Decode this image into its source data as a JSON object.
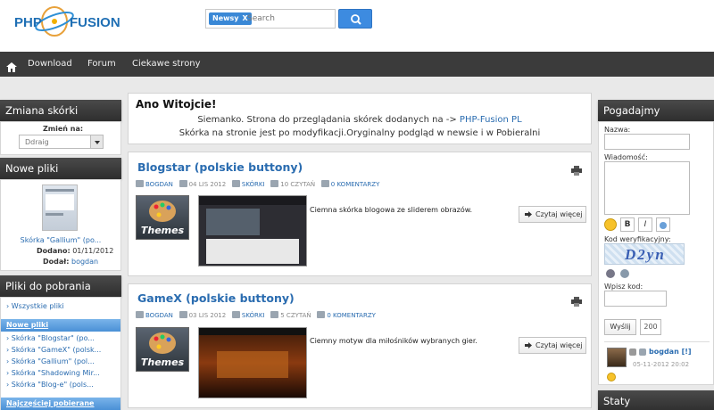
{
  "header": {
    "logo_text": "PHP-FUSION",
    "search": {
      "tag": "Newsy",
      "tag_close": "X",
      "placeholder": "Search",
      "value": ""
    }
  },
  "nav": {
    "items": [
      {
        "label": "Download"
      },
      {
        "label": "Forum"
      },
      {
        "label": "Ciekawe strony"
      }
    ]
  },
  "left": {
    "skin": {
      "title": "Zmiana skórki",
      "label": "Zmień na:",
      "selected": "Ddraig"
    },
    "new_files": {
      "title": "Nowe pliki",
      "item_link": "Skórka \"Gallium\" (po...",
      "added_label": "Dodano:",
      "added_value": "01/11/2012",
      "by_label": "Dodał:",
      "by_value": "bogdan"
    },
    "downloads": {
      "title": "Pliki do pobrania",
      "all": "Wszystkie pliki",
      "newest_header": "Nowe pliki",
      "items": [
        "Skórka \"Blogstar\" (po...",
        "Skórka \"GameX\" (polsk...",
        "Skórka \"Gallium\" (pol...",
        "Skórka \"Shadowing Mir...",
        "Skórka \"Blog-e\" (pols..."
      ],
      "most_header": "Najczęściej pobierane"
    }
  },
  "welcome": {
    "title": "Ano Witojcie!",
    "line1_prefix": "Siemanko. Strona do przeglądania skórek dodanych na ->",
    "line1_link": "PHP-Fusion PL",
    "line2": "Skórka na stronie jest po modyfikacji.Oryginalny podgląd w newsie i w Pobieralni"
  },
  "posts": [
    {
      "title": "Blogstar (polskie buttony)",
      "author": "BOGDAN",
      "date": "04 LIS 2012",
      "category": "SKÓRKI",
      "reads": "10 CZYTAŃ",
      "comments": "0 KOMENTARZY",
      "thumb_text": "Themes",
      "body": "Ciemna skórka blogowa ze sliderem obrazów.",
      "read_more": "Czytaj więcej"
    },
    {
      "title": "GameX (polskie buttony)",
      "author": "BOGDAN",
      "date": "03 LIS 2012",
      "category": "SKÓRKI",
      "reads": "5 CZYTAŃ",
      "comments": "0 KOMENTARZY",
      "thumb_text": "Themes",
      "body": "Ciemny motyw dla miłośników wybranych gier.",
      "read_more": "Czytaj więcej"
    }
  ],
  "shoutbox": {
    "title": "Pogadajmy",
    "name_label": "Nazwa:",
    "message_label": "Wiadomość:",
    "captcha_label": "Kod weryfikacyjny:",
    "captcha_text": "D2yn",
    "code_label": "Wpisz kod:",
    "send_button": "Wyślij",
    "char_count": "200",
    "shout_user": "bogdan",
    "shout_suffix": "[!]",
    "shout_date": "05-11-2012 20:02"
  },
  "stats": {
    "title": "Staty"
  },
  "colors": {
    "accent": "#2a6cb0",
    "nav_bg": "#3b3b3b",
    "button_blue": "#3d8be0"
  }
}
